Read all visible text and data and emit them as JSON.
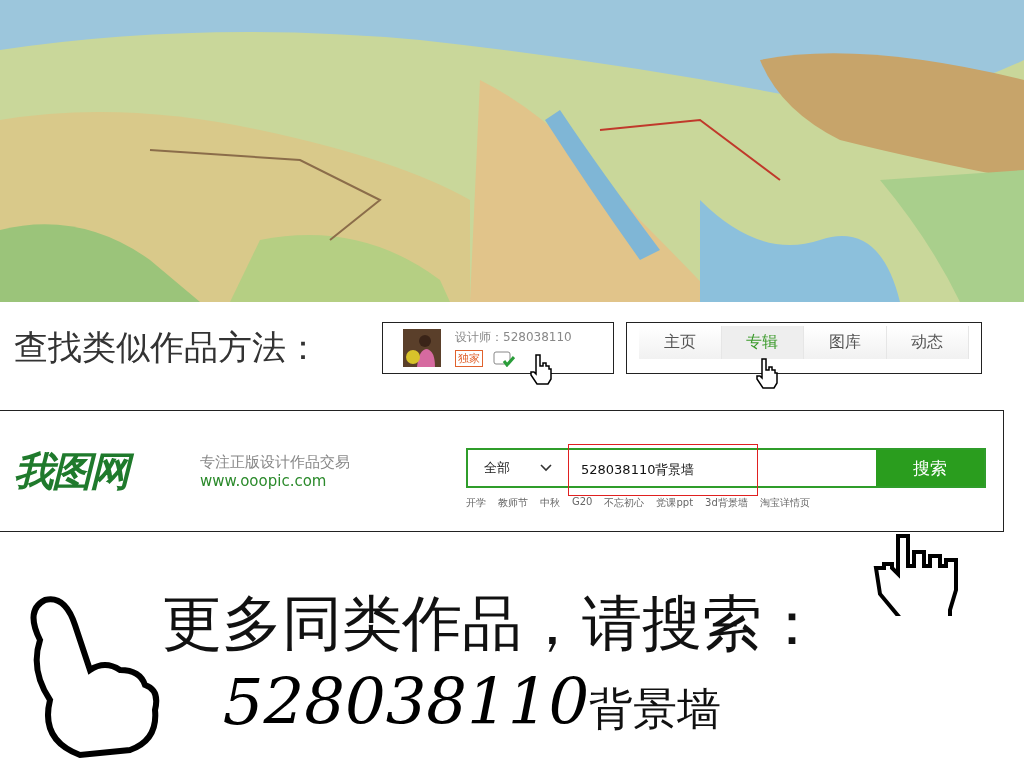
{
  "method_label": "查找类似作品方法：",
  "designer": {
    "label": "设计师：528038110",
    "badge": "独家"
  },
  "tabs": [
    {
      "label": "主页",
      "selected": false
    },
    {
      "label": "专辑",
      "selected": true
    },
    {
      "label": "图库",
      "selected": false
    },
    {
      "label": "动态",
      "selected": false
    }
  ],
  "site": {
    "logo": "我图网",
    "slogan": "专注正版设计作品交易",
    "url": "www.ooopic.com"
  },
  "search": {
    "category": "全部",
    "value": "528038110背景墙",
    "button": "搜索"
  },
  "hot_tags": [
    "开学",
    "教师节",
    "中秋",
    "G20",
    "不忘初心",
    "党课ppt",
    "3d背景墙",
    "淘宝详情页"
  ],
  "prompt": "更多同类作品，请搜索：",
  "keyword_number": "528038110",
  "keyword_text": "背景墙"
}
